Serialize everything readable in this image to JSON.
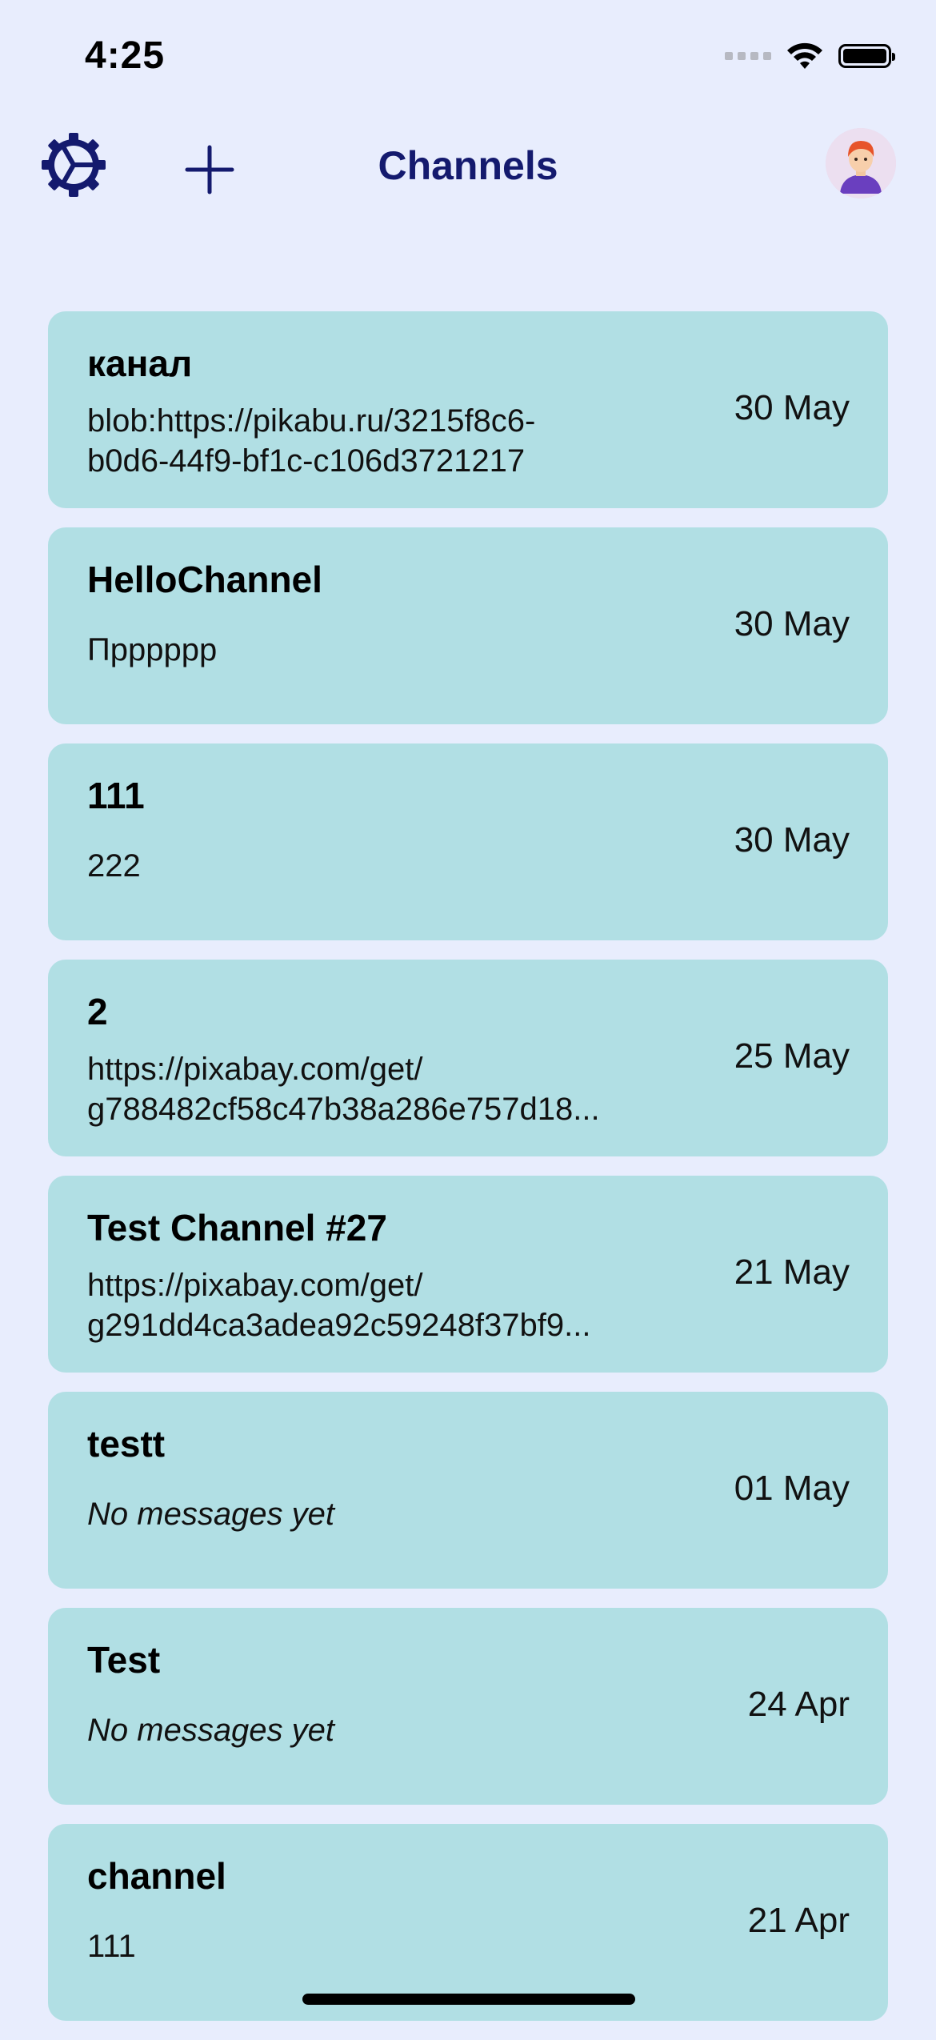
{
  "status_bar": {
    "time": "4:25"
  },
  "header": {
    "title": "Channels"
  },
  "colors": {
    "background": "#e8edfd",
    "card": "#b1dfe4",
    "accent": "#141a6e"
  },
  "channels": [
    {
      "name": "канал",
      "preview_line1": "blob:https://pikabu.ru/3215f8c6-",
      "preview_line2": "b0d6-44f9-bf1c-c106d3721217",
      "date": "30 May"
    },
    {
      "name": "HelloChannel",
      "preview": "Пpppppp",
      "date": "30 May"
    },
    {
      "name": "111",
      "preview": "222",
      "date": "30 May"
    },
    {
      "name": "2",
      "preview_line1": "https://pixabay.com/get/",
      "preview_line2": "g788482cf58c47b38a286e757d18...",
      "date": "25 May"
    },
    {
      "name": "Test Channel #27",
      "preview_line1": "https://pixabay.com/get/",
      "preview_line2": "g291dd4ca3adea92c59248f37bf9...",
      "date": "21 May"
    },
    {
      "name": "testt",
      "preview": "No messages yet",
      "date": "01 May"
    },
    {
      "name": "Test",
      "preview": "No messages yet",
      "date": "24 Apr"
    },
    {
      "name": "channel",
      "preview": "111",
      "date": "21 Apr"
    }
  ]
}
